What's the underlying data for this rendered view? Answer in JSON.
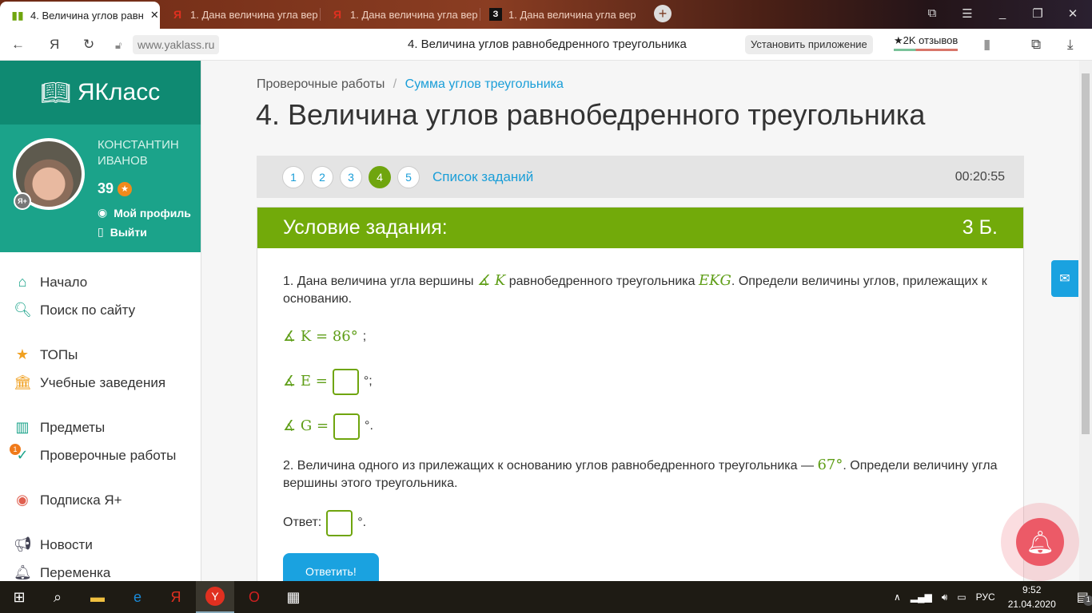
{
  "browser": {
    "tabs": [
      {
        "label": "4. Величина углов равн",
        "active": true
      },
      {
        "label": "1. Дана величина угла вер",
        "active": false
      },
      {
        "label": "1. Дана величина угла вер",
        "active": false
      },
      {
        "label": "1. Дана величина угла вер",
        "active": false
      }
    ],
    "url": "www.yaklass.ru",
    "page_title": "4. Величина углов равнобедренного треугольника",
    "install_label": "Установить приложение",
    "reviews_label": "★2K отзывов"
  },
  "sidebar": {
    "logo": "ЯКласс",
    "user_name_1": "КОНСТАНТИН",
    "user_name_2": "ИВАНОВ",
    "score": "39",
    "profile_link": "Мой профиль",
    "logout_link": "Выйти",
    "items": [
      {
        "label": "Начало"
      },
      {
        "label": "Поиск по сайту"
      },
      {
        "label": "ТОПы"
      },
      {
        "label": "Учебные заведения"
      },
      {
        "label": "Предметы"
      },
      {
        "label": "Проверочные работы",
        "badge": "1"
      },
      {
        "label": "Подписка Я+"
      },
      {
        "label": "Новости"
      },
      {
        "label": "Переменка"
      }
    ]
  },
  "main": {
    "breadcrumb_1": "Проверочные работы",
    "breadcrumb_sep": "/",
    "breadcrumb_2": "Сумма углов треугольника",
    "title": "4. Величина углов равнобедренного треугольника",
    "steps": [
      "1",
      "2",
      "3",
      "4",
      "5"
    ],
    "current_step": "4",
    "tasks_link": "Список заданий",
    "timer": "00:20:55",
    "card_title": "Условие задания:",
    "points": "3 Б.",
    "q1_a": "1. Дана величина угла вершины",
    "q1_k": "∡ K",
    "q1_b": "равнобедренного треугольника",
    "q1_tri": "EKG",
    "q1_c": ". Определи величины углов, прилежащих к основанию.",
    "given": "∡ K = 86°",
    "given_end": ";",
    "e_label": "∡ E =",
    "e_end": "°;",
    "g_label": "∡ G =",
    "g_end": "°.",
    "q2_a": "2. Величина одного из прилежащих к основанию углов равнобедренного треугольника —",
    "q2_val": "67°",
    "q2_b": ". Определи величину угла вершины этого треугольника.",
    "answer_label": "Ответ:",
    "answer_end": "°.",
    "submit": "Ответить!"
  },
  "taskbar": {
    "lang": "РУС",
    "time": "9:52",
    "date": "21.04.2020",
    "notif_count": "1"
  }
}
